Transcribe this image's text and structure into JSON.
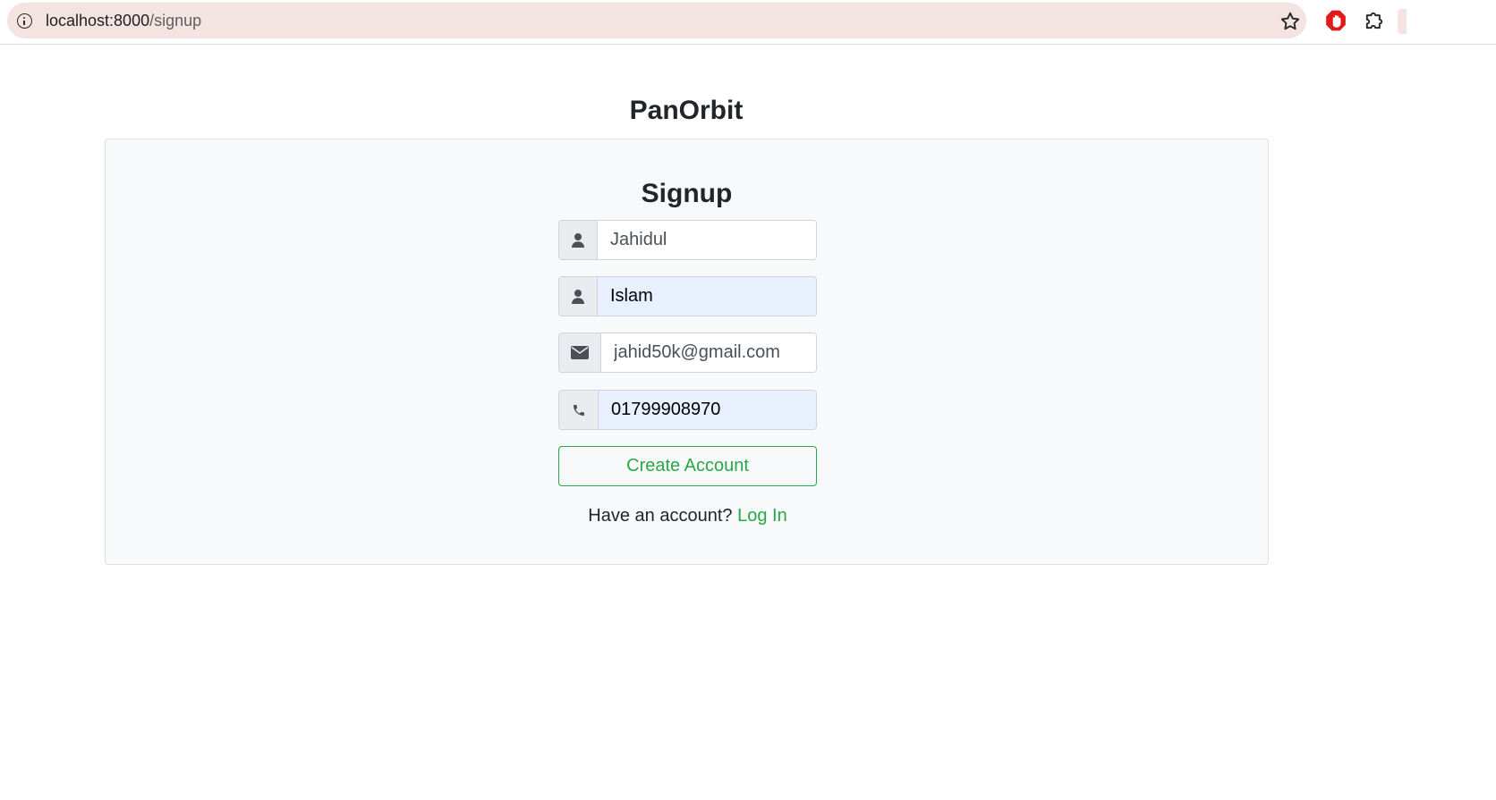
{
  "browser": {
    "url_host": "localhost:8000",
    "url_path": "/signup",
    "icons": [
      "site-info-icon",
      "star-icon",
      "ad-block-icon",
      "puzzle-icon"
    ]
  },
  "page": {
    "brand": "PanOrbit",
    "form_title": "Signup",
    "fields": {
      "first_name": {
        "value": "Jahidul",
        "icon": "user-icon"
      },
      "last_name": {
        "value": "Islam",
        "icon": "user-icon"
      },
      "email": {
        "value": "jahid50k@gmail.com",
        "icon": "envelope-icon"
      },
      "phone": {
        "value": "01799908970",
        "icon": "phone-icon"
      }
    },
    "submit_label": "Create Account",
    "footer_text": "Have an account?",
    "login_link": "Log In"
  },
  "colors": {
    "accent": "#28a745",
    "card_bg": "#f8f9fa",
    "autofill_bg": "#e8f0fe",
    "addon_bg": "#e9ecef"
  }
}
